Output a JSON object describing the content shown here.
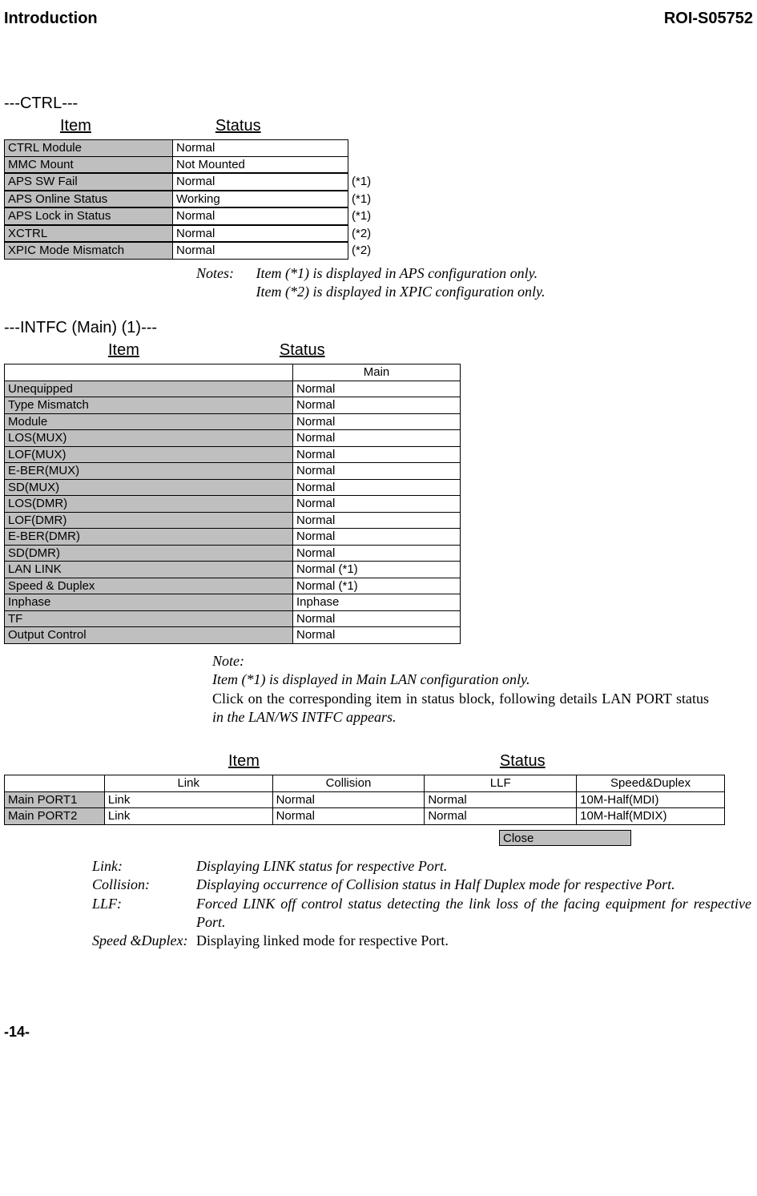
{
  "header": {
    "left": "Introduction",
    "right": "ROI-S05752"
  },
  "ctrl": {
    "section_title": "---CTRL---",
    "item_label": "Item",
    "status_label": "Status",
    "rows": [
      {
        "name": "CTRL Module",
        "status": "Normal",
        "annot": ""
      },
      {
        "name": "MMC Mount",
        "status": "Not Mounted",
        "annot": ""
      },
      {
        "name": "APS SW Fail",
        "status": "Normal",
        "annot": "(*1)"
      },
      {
        "name": "APS Online Status",
        "status": "Working",
        "annot": "(*1)"
      },
      {
        "name": "APS Lock in Status",
        "status": "Normal",
        "annot": "(*1)"
      },
      {
        "name": "XCTRL",
        "status": "Normal",
        "annot": "(*2)"
      },
      {
        "name": "XPIC Mode Mismatch",
        "status": "Normal",
        "annot": "(*2)"
      }
    ],
    "notes_label": "Notes:",
    "notes_line1": "Item (*1) is displayed in APS configuration only.",
    "notes_line2": "Item (*2) is displayed in XPIC configuration only."
  },
  "intfc": {
    "section_title": "---INTFC (Main) (1)---",
    "item_label": "Item",
    "status_label": "Status",
    "header_main": "Main",
    "rows": [
      {
        "name": "Unequipped",
        "status": "Normal"
      },
      {
        "name": "Type Mismatch",
        "status": "Normal"
      },
      {
        "name": "Module",
        "status": "Normal"
      },
      {
        "name": "LOS(MUX)",
        "status": "Normal"
      },
      {
        "name": "LOF(MUX)",
        "status": "Normal"
      },
      {
        "name": "E-BER(MUX)",
        "status": "Normal"
      },
      {
        "name": "SD(MUX)",
        "status": "Normal"
      },
      {
        "name": "LOS(DMR)",
        "status": "Normal"
      },
      {
        "name": "LOF(DMR)",
        "status": "Normal"
      },
      {
        "name": "E-BER(DMR)",
        "status": "Normal"
      },
      {
        "name": "SD(DMR)",
        "status": "Normal"
      },
      {
        "name": "LAN LINK",
        "status": "Normal (*1)"
      },
      {
        "name": "Speed & Duplex",
        "status": "Normal (*1)"
      },
      {
        "name": "Inphase",
        "status": "Inphase"
      },
      {
        "name": "TF",
        "status": "Normal"
      },
      {
        "name": "Output Control",
        "status": "Normal"
      }
    ],
    "note_label": "Note:",
    "note_italic": "Item (*1) is displayed in Main LAN configuration only.",
    "note_roman_1": "Click on the corresponding item in status block, following details LAN PORT status ",
    "note_italic_2": "in the LAN/WS INTFC appears."
  },
  "lan": {
    "item_label": "Item",
    "status_label": "Status",
    "headers": [
      "",
      "Link",
      "Collision",
      "LLF",
      "Speed&Duplex"
    ],
    "rows": [
      {
        "port": "Main PORT1",
        "link": "Link",
        "collision": "Normal",
        "llf": "Normal",
        "speed": "10M-Half(MDI)"
      },
      {
        "port": "Main PORT2",
        "link": "Link",
        "collision": "Normal",
        "llf": "Normal",
        "speed": "10M-Half(MDIX)"
      }
    ],
    "close": "Close"
  },
  "defs": {
    "link_term": "Link:",
    "link_body": "Displaying LINK status for respective Port.",
    "collision_term": "Collision:",
    "collision_body": "Displaying occurrence of Collision status in Half Duplex mode for respective Port.",
    "llf_term": "LLF:",
    "llf_body": "Forced LINK off control status detecting the link loss of the facing equipment for respective Port.",
    "sd_term": "Speed &Duplex:",
    "sd_body": "Displaying linked mode for respective Port."
  },
  "page_num": "-14-"
}
